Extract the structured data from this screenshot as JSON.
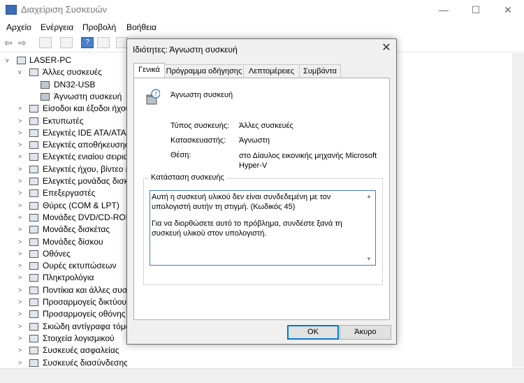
{
  "window": {
    "title": "Διαχείριση Συσκευών",
    "controls": [
      "—",
      "☐",
      "✕"
    ]
  },
  "menu": [
    "Αρχείο",
    "Ενέργεια",
    "Προβολή",
    "Βοήθεια"
  ],
  "tree": {
    "root": "LASER-PC",
    "items": [
      {
        "label": "Άλλες συσκευές",
        "level": 1,
        "expanded": true
      },
      {
        "label": "DN32-USB",
        "level": 2
      },
      {
        "label": "Άγνωστη συσκευή",
        "level": 2
      },
      {
        "label": "Είσοδοι και έξοδοι ήχου",
        "level": 1
      },
      {
        "label": "Εκτυπωτές",
        "level": 1
      },
      {
        "label": "Ελεγκτές IDE ATA/ATAPI",
        "level": 1
      },
      {
        "label": "Ελεγκτές αποθήκευσης",
        "level": 1
      },
      {
        "label": "Ελεγκτές ενιαίου σειριακού",
        "level": 1
      },
      {
        "label": "Ελεγκτές ήχου, βίντεο και",
        "level": 1
      },
      {
        "label": "Ελεγκτές μονάδας δισκέτας",
        "level": 1
      },
      {
        "label": "Επεξεργαστές",
        "level": 1
      },
      {
        "label": "Θύρες (COM & LPT)",
        "level": 1
      },
      {
        "label": "Μονάδες DVD/CD-ROM",
        "level": 1
      },
      {
        "label": "Μονάδες δισκέτας",
        "level": 1
      },
      {
        "label": "Μονάδες δίσκου",
        "level": 1
      },
      {
        "label": "Οθόνες",
        "level": 1
      },
      {
        "label": "Ουρές εκτυπώσεων",
        "level": 1
      },
      {
        "label": "Πληκτρολόγια",
        "level": 1
      },
      {
        "label": "Ποντίκια και άλλες συσκευές",
        "level": 1
      },
      {
        "label": "Προσαρμογείς δικτύου",
        "level": 1
      },
      {
        "label": "Προσαρμογείς οθόνης",
        "level": 1
      },
      {
        "label": "Σκιώδη αντίγραφα τόμου",
        "level": 1
      },
      {
        "label": "Στοιχεία λογισμικού",
        "level": 1
      },
      {
        "label": "Συσκευές ασφαλείας",
        "level": 1
      },
      {
        "label": "Συσκευές διασύνδεσης χρήστη",
        "level": 1
      }
    ]
  },
  "dialog": {
    "title": "Ιδιότητες: Άγνωστη συσκευή",
    "close": "✕",
    "tabs": [
      "Γενικά",
      "Πρόγραμμα οδήγησης",
      "Λεπτομέρειες",
      "Συμβάντα"
    ],
    "device_name": "Άγνωστη συσκευή",
    "props": [
      {
        "label": "Τύπος συσκευής:",
        "value": "Άλλες συσκευές"
      },
      {
        "label": "Κατασκευαστής:",
        "value": "Άγνωστη"
      },
      {
        "label": "Θέση:",
        "value": "στο Δίαυλος εικονικής μηχανής Microsoft Hyper-V"
      }
    ],
    "status_legend": "Κατάσταση συσκευής",
    "status_p1": "Αυτή η συσκευή υλικού δεν είναι συνδεδεμένη με τον υπολογιστή αυτήν τη στιγμή. (Κωδικός 45)",
    "status_p2": "Για να διορθώσετε αυτό το πρόβλημα, συνδέστε ξανά τη συσκευή υλικού στον υπολογιστή.",
    "ok": "OK",
    "cancel": "Άκυρο"
  }
}
